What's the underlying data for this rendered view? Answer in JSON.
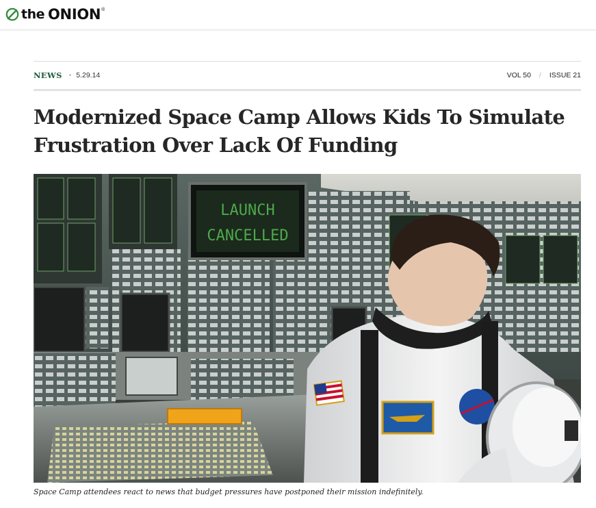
{
  "site": {
    "logo_the": "the",
    "logo_onion": "ONION",
    "logo_reg": "®"
  },
  "meta": {
    "section": "NEWS",
    "date": "5.29.14",
    "volume": "VOL 50",
    "issue": "ISSUE 21"
  },
  "article": {
    "headline": "Modernized Space Camp Allows Kids To Simulate Frustration Over Lack Of Funding",
    "caption": "Space Camp attendees react to news that budget pressures have postponed their mission indefinitely."
  },
  "image": {
    "screen_line1": "LAUNCH",
    "screen_line2": "CANCELLED"
  },
  "colors": {
    "section": "#1e5b3f",
    "logo_globe": "#2f8a3a",
    "screen_text": "#4fa84c"
  },
  "icons": [
    "globe-icon"
  ]
}
